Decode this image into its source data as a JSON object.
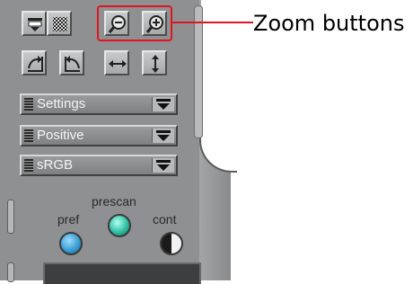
{
  "annotation": {
    "label": "Zoom buttons",
    "color": "#e01522"
  },
  "toolbar_row1": [
    {
      "icon": "scan-area-icon"
    },
    {
      "icon": "grain-pattern-icon"
    },
    {
      "icon": "zoom-out-icon"
    },
    {
      "icon": "zoom-in-icon"
    }
  ],
  "toolbar_row2": [
    {
      "icon": "rotate-right-icon"
    },
    {
      "icon": "rotate-left-icon"
    },
    {
      "icon": "flip-horizontal-icon"
    },
    {
      "icon": "flip-vertical-icon"
    }
  ],
  "selects": {
    "settings": "Settings",
    "film_type": "Positive",
    "color_space": "sRGB"
  },
  "modes": {
    "pref": "pref",
    "prescan": "prescan",
    "cont": "cont"
  },
  "colors": {
    "panel": "#8f9091",
    "pref_button": "#3a9ed6",
    "prescan_button": "#2fbfa5"
  }
}
